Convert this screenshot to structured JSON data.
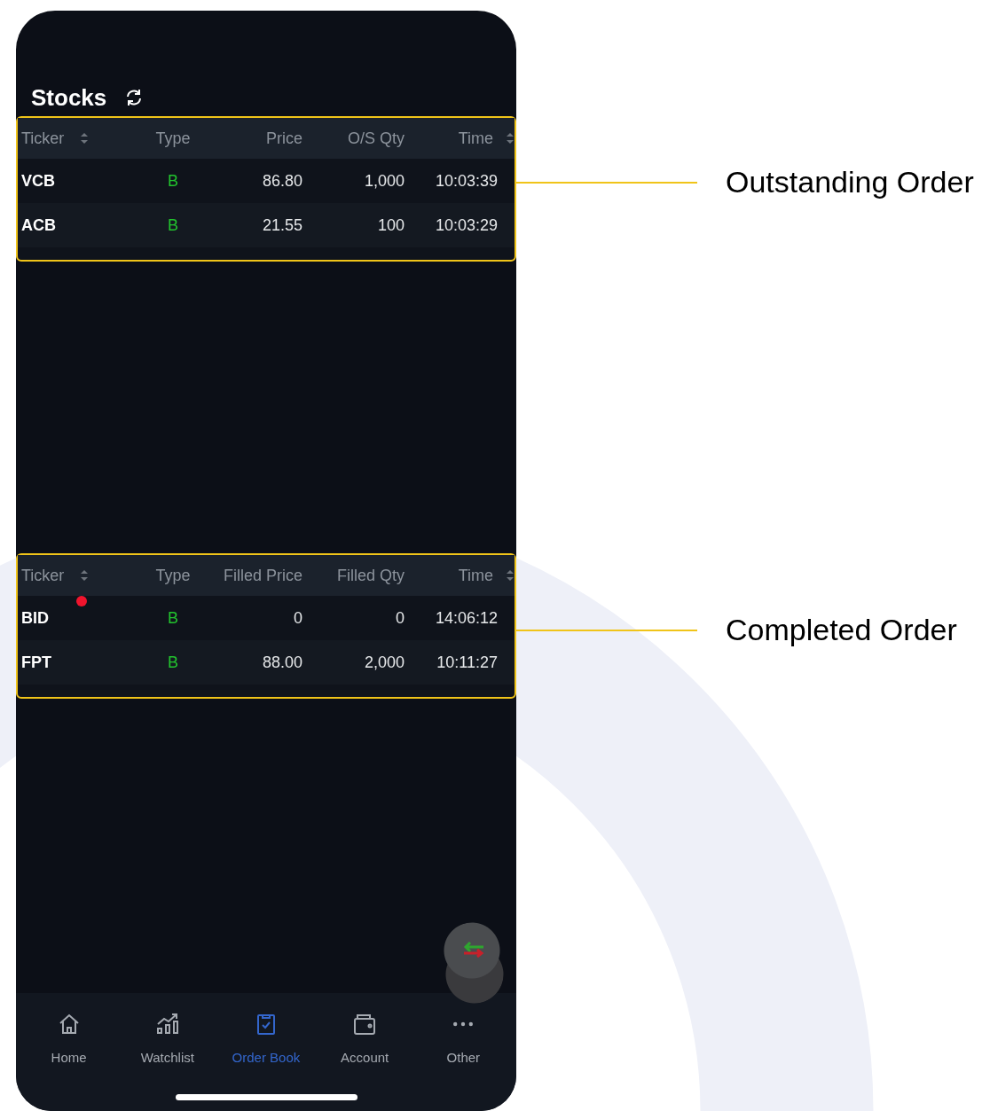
{
  "header": {
    "title": "Stocks"
  },
  "outstanding": {
    "annotation": "Outstanding Order",
    "columns": [
      {
        "label": "Ticker",
        "sortable": true
      },
      {
        "label": "Type",
        "sortable": false
      },
      {
        "label": "Price",
        "sortable": false
      },
      {
        "label": "O/S Qty",
        "sortable": false
      },
      {
        "label": "Time",
        "sortable": true
      }
    ],
    "rows": [
      {
        "ticker": "VCB",
        "type": "B",
        "price": "86.80",
        "qty": "1,000",
        "time": "10:03:39",
        "unread": false
      },
      {
        "ticker": "ACB",
        "type": "B",
        "price": "21.55",
        "qty": "100",
        "time": "10:03:29",
        "unread": false
      }
    ]
  },
  "completed": {
    "annotation": "Completed Order",
    "columns": [
      {
        "label": "Ticker",
        "sortable": true
      },
      {
        "label": "Type",
        "sortable": false
      },
      {
        "label": "Filled Price",
        "sortable": false
      },
      {
        "label": "Filled Qty",
        "sortable": false
      },
      {
        "label": "Time",
        "sortable": true
      }
    ],
    "rows": [
      {
        "ticker": "BID",
        "type": "B",
        "price": "0",
        "qty": "0",
        "time": "14:06:12",
        "unread": true
      },
      {
        "ticker": "FPT",
        "type": "B",
        "price": "88.00",
        "qty": "2,000",
        "time": "10:11:27",
        "unread": false
      }
    ]
  },
  "nav": [
    {
      "label": "Home",
      "kind": "home",
      "selected": false
    },
    {
      "label": "Watchlist",
      "kind": "watchlist",
      "selected": false
    },
    {
      "label": "Order Book",
      "kind": "orderbook",
      "selected": true
    },
    {
      "label": "Account",
      "kind": "account",
      "selected": false
    },
    {
      "label": "Other",
      "kind": "other",
      "selected": false
    }
  ]
}
